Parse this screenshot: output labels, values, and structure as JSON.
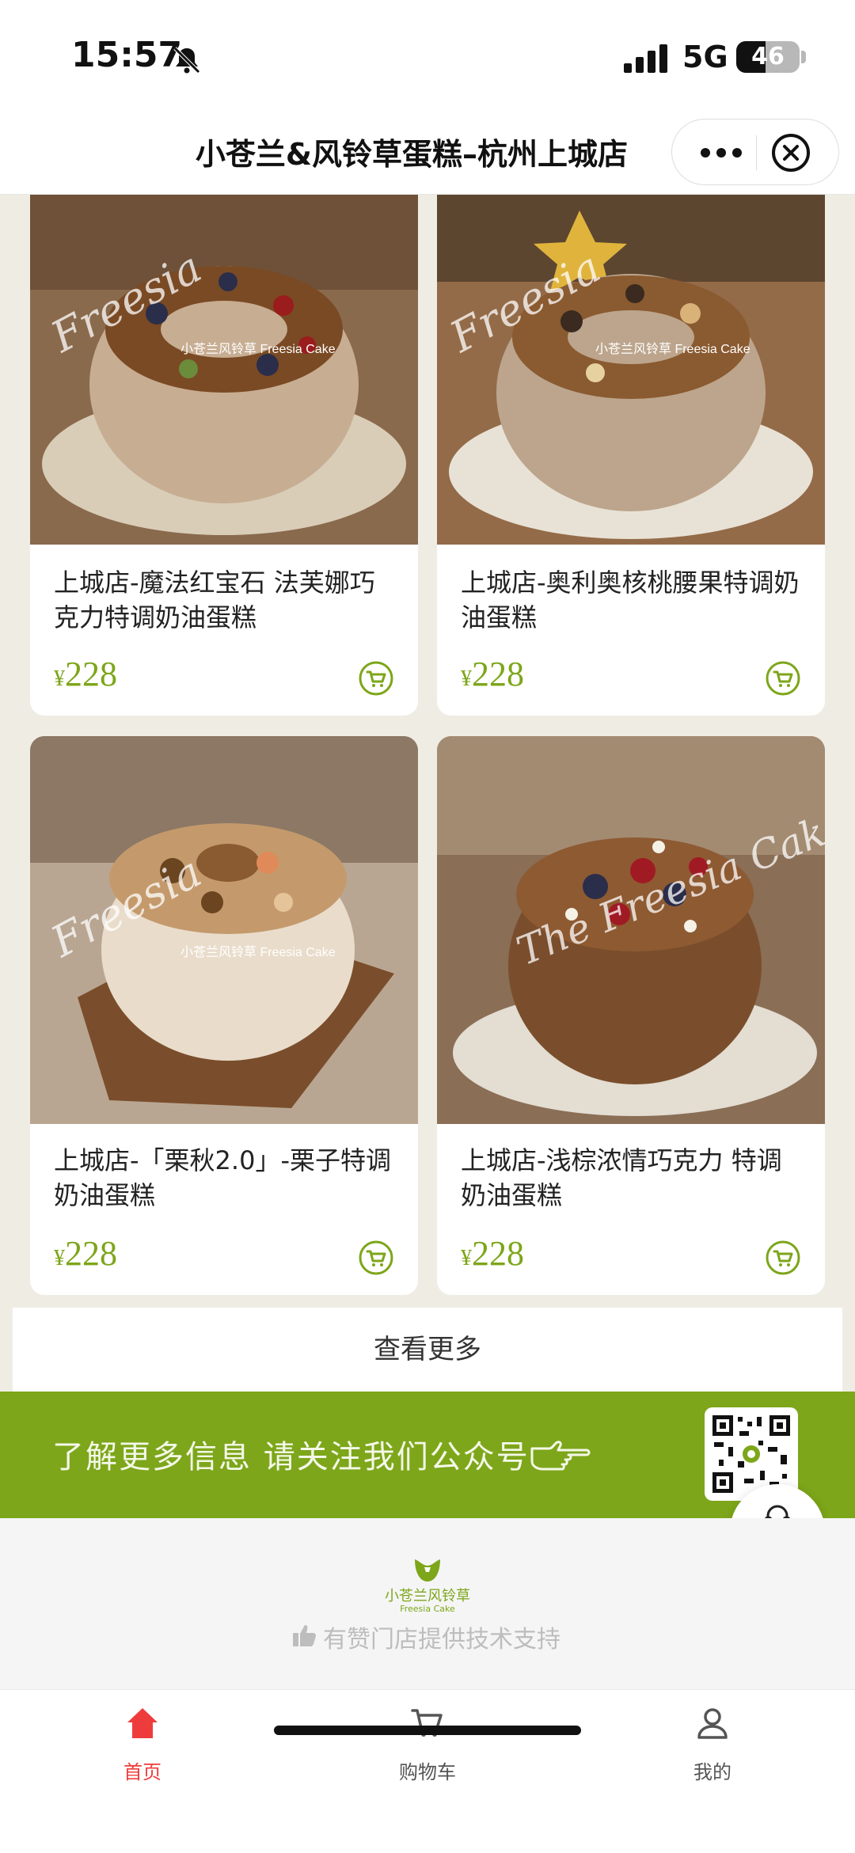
{
  "status_bar": {
    "time": "15:57",
    "network": "5G",
    "battery": "46",
    "battery_level": 0.46
  },
  "nav": {
    "title": "小苍兰&风铃草蛋糕–杭州上城店"
  },
  "products": [
    {
      "name": "上城店-魔法红宝石 法芙娜巧克力特调奶油蛋糕",
      "currency": "¥",
      "price": "228",
      "image": "cake-nut-wreath-photo",
      "watermark": "小苍兰风铃草 Freesia Cake"
    },
    {
      "name": "上城店-奥利奥核桃腰果特调奶油蛋糕",
      "currency": "¥",
      "price": "228",
      "image": "cake-oreo-walnut-photo",
      "watermark": "小苍兰风铃草 Freesia Cake"
    },
    {
      "name": "上城店-「栗秋2.0」-栗子特调奶油蛋糕",
      "currency": "¥",
      "price": "228",
      "image": "cake-chestnut-photo",
      "watermark": "小苍兰风铃草 Freesia Cake"
    },
    {
      "name": "上城店-浅棕浓情巧克力 特调奶油蛋糕",
      "currency": "¥",
      "price": "228",
      "image": "cake-chocolate-berry-photo",
      "watermark": "The Freesia Cake"
    }
  ],
  "more_button": "查看更多",
  "follow_banner": {
    "text": "了解更多信息 请关注我们公众号"
  },
  "support_button": {
    "label": "客服"
  },
  "footer": {
    "brand_cn": "小苍兰风铃草",
    "brand_en": "Freesia Cake",
    "tech_support": "有赞门店提供技术支持"
  },
  "tabs": [
    {
      "label": "首页",
      "icon": "home-icon",
      "active": true
    },
    {
      "label": "购物车",
      "icon": "cart-icon",
      "active": false
    },
    {
      "label": "我的",
      "icon": "user-icon",
      "active": false
    }
  ],
  "colors": {
    "brand_green": "#7da61a",
    "active_red": "#ee3c3c",
    "background": "#efede3"
  }
}
